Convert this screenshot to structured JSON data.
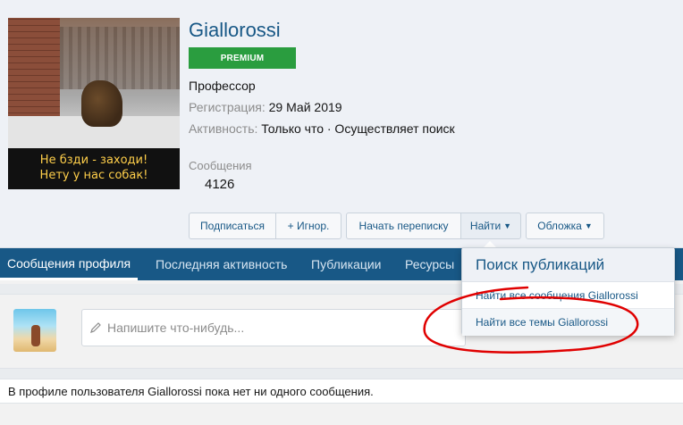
{
  "profile": {
    "username": "Giallorossi",
    "banner": "PREMIUM",
    "user_title": "Профессор",
    "avatar_caption_line1": "Не бзди - заходи!",
    "avatar_caption_line2": "Нету  у  нас собак!",
    "registration_label": "Регистрация:",
    "registration_value": "29 Май 2019",
    "activity_label": "Активность:",
    "activity_value": "Только что · Осуществляет поиск",
    "messages_label": "Сообщения",
    "messages_value": "4126"
  },
  "buttons": {
    "follow": "Подписаться",
    "ignore": "+ Игнор.",
    "message": "Начать переписку",
    "find": "Найти",
    "cover": "Обложка"
  },
  "tabs": [
    {
      "label": "Сообщения профиля"
    },
    {
      "label": "Последняя активность"
    },
    {
      "label": "Публикации"
    },
    {
      "label": "Ресурсы"
    }
  ],
  "composer": {
    "placeholder": "Напишите что-нибудь..."
  },
  "empty_message": "В профиле пользователя Giallorossi пока нет ни одного сообщения.",
  "dropdown": {
    "title": "Поиск публикаций",
    "items": [
      {
        "label": "Найти все сообщения Giallorossi"
      },
      {
        "label": "Найти все темы Giallorossi"
      }
    ]
  },
  "colors": {
    "accent": "#185886",
    "premium": "#2a9d3f",
    "annotation": "#e00000"
  }
}
